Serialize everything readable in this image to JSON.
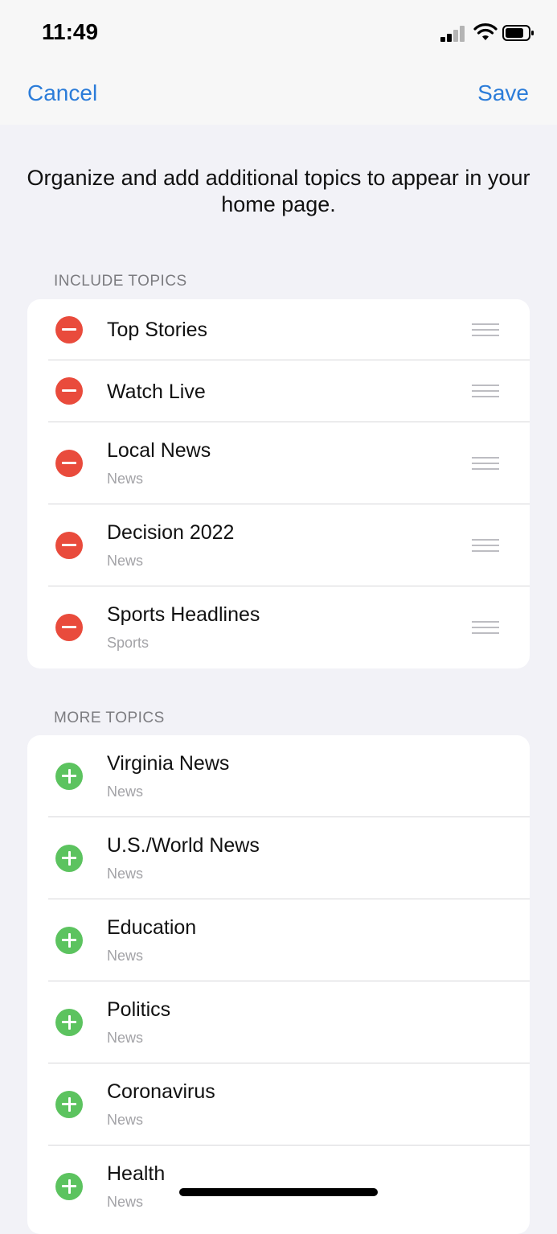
{
  "status_bar": {
    "time": "11:49"
  },
  "nav": {
    "cancel_label": "Cancel",
    "save_label": "Save"
  },
  "intro_text": "Organize and add additional topics to appear in your home page.",
  "include_section": {
    "header": "INCLUDE TOPICS",
    "items": [
      {
        "title": "Top Stories",
        "subtitle": ""
      },
      {
        "title": "Watch Live",
        "subtitle": ""
      },
      {
        "title": "Local News",
        "subtitle": "News"
      },
      {
        "title": "Decision 2022",
        "subtitle": "News"
      },
      {
        "title": "Sports Headlines",
        "subtitle": "Sports"
      }
    ]
  },
  "more_section": {
    "header": "MORE TOPICS",
    "items": [
      {
        "title": "Virginia News",
        "subtitle": "News"
      },
      {
        "title": "U.S./World News",
        "subtitle": "News"
      },
      {
        "title": "Education",
        "subtitle": "News"
      },
      {
        "title": "Politics",
        "subtitle": "News"
      },
      {
        "title": "Coronavirus",
        "subtitle": "News"
      },
      {
        "title": "Health",
        "subtitle": "News"
      }
    ]
  },
  "icons": {
    "remove": "minus-circle-icon",
    "add": "plus-circle-icon",
    "reorder": "reorder-grip-icon"
  },
  "colors": {
    "accent": "#2b7cd9",
    "remove": "#e94b3c",
    "add": "#5cc35f",
    "background": "#f2f2f7"
  }
}
